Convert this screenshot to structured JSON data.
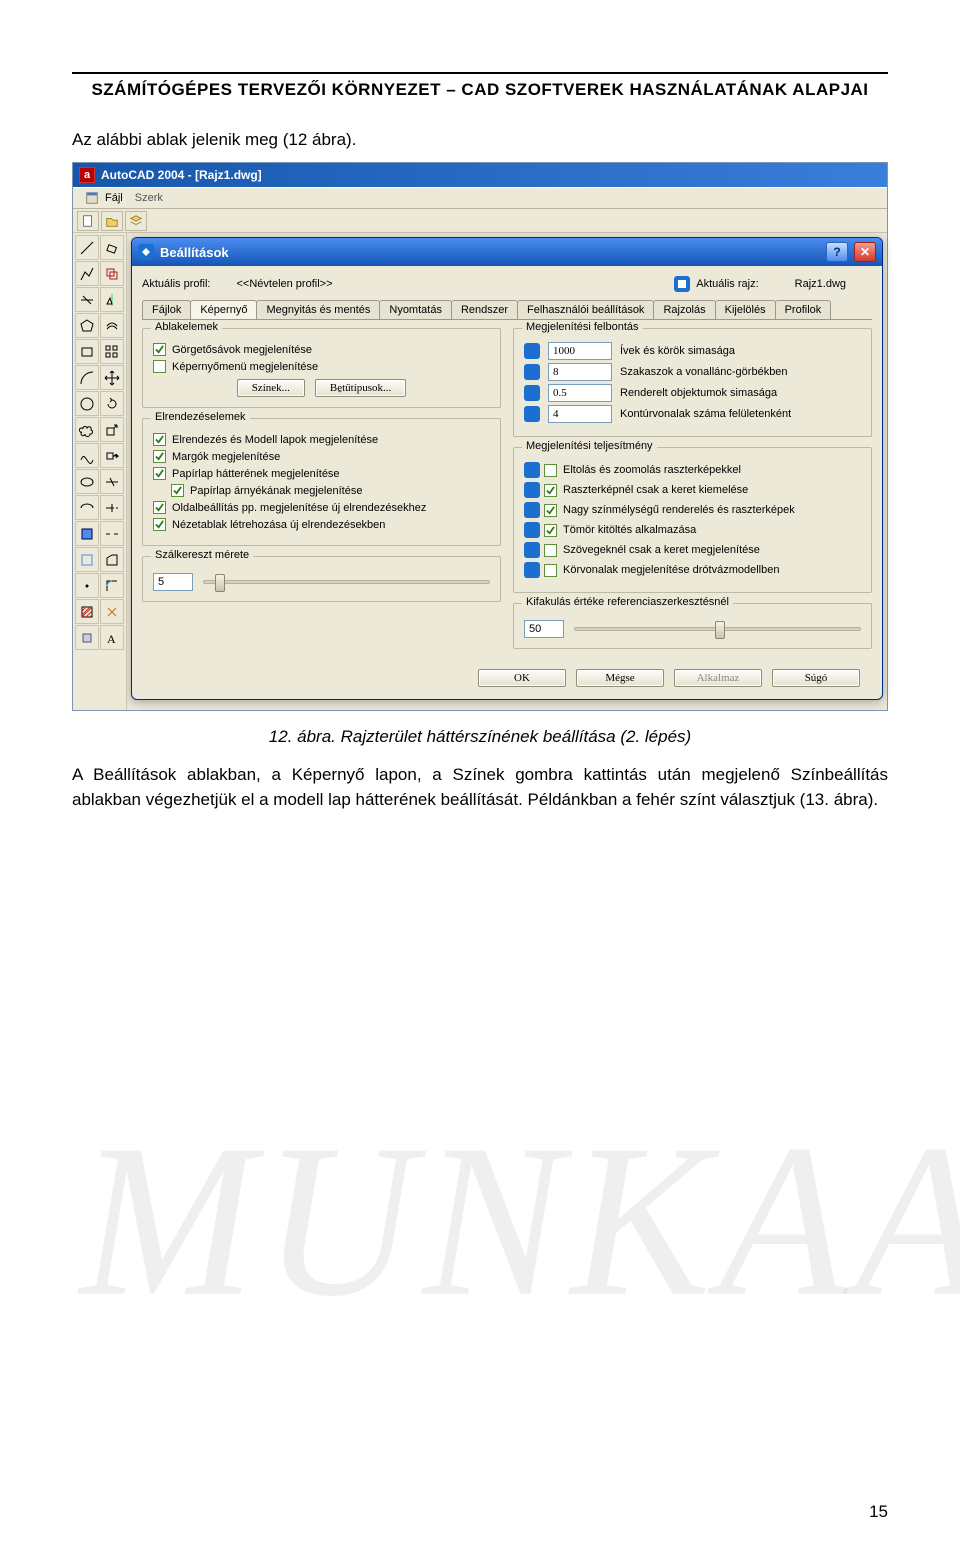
{
  "doc": {
    "header_title": "SZÁMÍTÓGÉPES TERVEZŐI KÖRNYEZET – CAD SZOFTVEREK HASZNÁLATÁNAK ALAPJAI",
    "intro": "Az alábbi ablak jelenik meg (12 ábra).",
    "caption": "12. ábra. Rajzterület háttérszínének beállítása (2. lépés)",
    "after": "A Beállítások ablakban, a Képernyő lapon, a Színek gombra kattintás után megjelenő Színbeállítás ablakban végezhetjük el a modell lap hátterének beállítását. Példánkban a fehér színt választjuk (13. ábra).",
    "page_no": "15",
    "watermark": "MUNKAA"
  },
  "acad": {
    "title": "AutoCAD 2004 - [Rajz1.dwg]",
    "file_menu": "Fájl",
    "szerk": "Szerk"
  },
  "dialog": {
    "title": "Beállítások",
    "profile_label": "Aktuális profil:",
    "profile_value": "<<Névtelen profil>>",
    "drawing_label": "Aktuális rajz:",
    "drawing_value": "Rajz1.dwg",
    "tabs": [
      "Fájlok",
      "Képernyő",
      "Megnyitás és mentés",
      "Nyomtatás",
      "Rendszer",
      "Felhasználói beállítások",
      "Rajzolás",
      "Kijelölés",
      "Profilok"
    ],
    "groups": {
      "window_elements": {
        "title": "Ablakelemek",
        "scrollbars": "Görgetősávok megjelenítése",
        "screenmenu": "Képernyőmenü megjelenítése",
        "colors_btn": "Színek...",
        "fonts_btn": "Be̱tűtípusok..."
      },
      "resolution": {
        "title": "Megjelenítési felbontás",
        "r1": {
          "val": "1000",
          "lbl": "Ívek és körök simasága"
        },
        "r2": {
          "val": "8",
          "lbl": "Szakaszok a vonallánc-görbékben"
        },
        "r3": {
          "val": "0.5",
          "lbl": "Renderelt objektumok simasága"
        },
        "r4": {
          "val": "4",
          "lbl": "Kontúrvonalak száma felületenként"
        }
      },
      "layout": {
        "title": "Elrendezéselemek",
        "l1": "Elrendezés és Modell lapok megjelenítése",
        "l2": "Margók megjelenítése",
        "l3": "Papírlap hátterének megjelenítése",
        "l4": "Papírlap árnyékának megjelenítése",
        "l5": "Oldalbeállítás pp. megjelenítése új elrendezésekhez",
        "l6": "Nézetablak létrehozása új elrendezésekben"
      },
      "perf": {
        "title": "Megjelenítési teljesítmény",
        "p1": "Eltolás és zoomolás raszterképekkel",
        "p2": "Raszterképnél csak a  keret kiemelése",
        "p3": "Nagy színmélységű renderelés és raszterképek",
        "p4": "Tömör kitöltés alkalmazása",
        "p5": "Szövegeknél csak a keret megjelenítése",
        "p6": "Körvonalak megjelenítése drótvázmodellben"
      },
      "crosshair": {
        "title": "Szálkereszt mérete",
        "value": "5"
      },
      "fade": {
        "title": "Kifakulás értéke referenciaszerkesztésnél",
        "value": "50"
      }
    },
    "ok": "OK",
    "cancel": "Mégse",
    "apply": "Alkalmaz",
    "help": "Súgó"
  }
}
